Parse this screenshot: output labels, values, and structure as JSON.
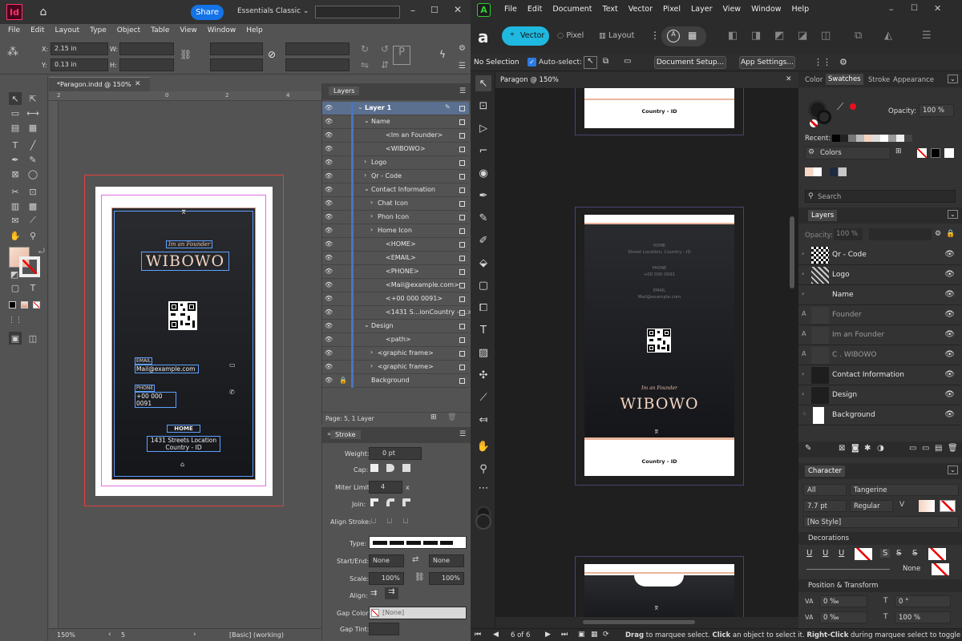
{
  "indesign": {
    "logo": "Id",
    "share": "Share",
    "workspace": "Essentials Classic",
    "menu": [
      "File",
      "Edit",
      "Layout",
      "Type",
      "Object",
      "Table",
      "View",
      "Window",
      "Help"
    ],
    "control": {
      "x_label": "X:",
      "x_val": "2.15 in",
      "y_label": "Y:",
      "y_val": "0.13 in",
      "w_label": "W:",
      "h_label": "H:"
    },
    "doc_tab": "*Paragon.indd @ 150%",
    "ruler": [
      "2",
      "0",
      "2",
      "4"
    ],
    "card": {
      "tagline": "Im an Founder",
      "name": "WIBOWO",
      "email_label": "EMAIL",
      "email": "Mail@example.com",
      "phone_label": "PHONE",
      "phone": "+00 000 0091",
      "home": "HOME",
      "address1": "1431 Streets Location",
      "address2": "Country - ID"
    },
    "status": {
      "zoom": "150%",
      "page": "5",
      "style": "[Basic] (working)"
    },
    "layers": {
      "title": "Layers",
      "footer": "Page: 5, 1 Layer",
      "rows": [
        {
          "name": "Layer 1",
          "indent": 0,
          "arrow": "⌄"
        },
        {
          "name": "Name",
          "indent": 1,
          "arrow": "⌄"
        },
        {
          "name": "<Im an Founder>",
          "indent": 3,
          "arrow": ""
        },
        {
          "name": "<WIBOWO>",
          "indent": 3,
          "arrow": ""
        },
        {
          "name": "Logo",
          "indent": 1,
          "arrow": "›"
        },
        {
          "name": "Qr - Code",
          "indent": 1,
          "arrow": "›"
        },
        {
          "name": "Contact Information",
          "indent": 1,
          "arrow": "⌄"
        },
        {
          "name": "Chat Icon",
          "indent": 2,
          "arrow": "›"
        },
        {
          "name": "Phon Icon",
          "indent": 2,
          "arrow": "›"
        },
        {
          "name": "Home Icon",
          "indent": 2,
          "arrow": "›"
        },
        {
          "name": "<HOME>",
          "indent": 3,
          "arrow": ""
        },
        {
          "name": "<EMAIL>",
          "indent": 3,
          "arrow": ""
        },
        {
          "name": "<PHONE>",
          "indent": 3,
          "arrow": ""
        },
        {
          "name": "<Mail@example.com>",
          "indent": 3,
          "arrow": ""
        },
        {
          "name": "<+00 000 0091>",
          "indent": 3,
          "arrow": ""
        },
        {
          "name": "<1431 S...ionCountry - ...>",
          "indent": 3,
          "arrow": ""
        },
        {
          "name": "Design",
          "indent": 1,
          "arrow": "⌄"
        },
        {
          "name": "<path>",
          "indent": 3,
          "arrow": ""
        },
        {
          "name": "<graphic frame>",
          "indent": 2,
          "arrow": "›"
        },
        {
          "name": "<graphic frame>",
          "indent": 2,
          "arrow": "›"
        },
        {
          "name": "Background",
          "indent": 1,
          "arrow": ""
        }
      ]
    },
    "stroke": {
      "title": "Stroke",
      "weight_label": "Weight:",
      "weight": "0 pt",
      "cap_label": "Cap:",
      "miter_label": "Miter Limit:",
      "miter": "4",
      "miter_x": "x",
      "join_label": "Join:",
      "align_label": "Align Stroke:",
      "type_label": "Type:",
      "startend_label": "Start/End:",
      "start": "None",
      "end": "None",
      "scale_label": "Scale:",
      "scale1": "100%",
      "scale2": "100%",
      "align2_label": "Align:",
      "gapcolor_label": "Gap Color:",
      "gapcolor": "[None]",
      "gaptint_label": "Gap Tint:"
    }
  },
  "affinity": {
    "menu": [
      "File",
      "Edit",
      "Document",
      "Text",
      "Vector",
      "Pixel",
      "Layer",
      "View",
      "Window",
      "Help"
    ],
    "personas": {
      "vector": "Vector",
      "pixel": "Pixel",
      "layout": "Layout"
    },
    "context": {
      "no_selection": "No Selection",
      "autoselect": "Auto-select:",
      "doc_setup": "Document Setup...",
      "app_settings": "App Settings..."
    },
    "doc_tab": "Paragon @ 150%",
    "card_top": {
      "country": "Country - ID"
    },
    "card_mid": {
      "home_label": "HOME",
      "address": "Street Location, Country - ID",
      "phone_label": "PHONE",
      "phone": "+00 000 0091",
      "email_label": "EMAIL",
      "email": "Mail@example.com",
      "tagline": "Im an Founder",
      "name": "WIBOWO",
      "country": "Country - ID"
    },
    "status": {
      "pages": "6 of 6",
      "hint_bold1": "Drag",
      "hint1": " to marquee select. ",
      "hint_bold2": "Click",
      "hint2": " an object to select it. ",
      "hint_bold3": "Right-Click",
      "hint3": " during marquee select to toggle in"
    },
    "swatches": {
      "tabs": [
        "Color",
        "Swatches",
        "Stroke",
        "Appearance"
      ],
      "opacity_label": "Opacity:",
      "opacity": "100 %",
      "recent_label": "Recent:",
      "palette": "Colors",
      "search": "Search"
    },
    "layers": {
      "title": "Layers",
      "opacity_label": "Opacity:",
      "opacity": "100 %",
      "rows": [
        {
          "name": "Qr - Code",
          "thumb": "qr"
        },
        {
          "name": "Logo",
          "thumb": "logo"
        },
        {
          "name": "Name",
          "thumb": "none"
        },
        {
          "name": "Founder",
          "thumb": "text",
          "prefix": "A"
        },
        {
          "name": "Im an Founder",
          "thumb": "text",
          "prefix": "A"
        },
        {
          "name": "C . WIBOWO",
          "thumb": "text",
          "prefix": "A"
        },
        {
          "name": "Contact Information",
          "thumb": "dark"
        },
        {
          "name": "Design",
          "thumb": "dark"
        },
        {
          "name": "Background",
          "thumb": "white"
        }
      ]
    },
    "character": {
      "title": "Character",
      "scope": "All",
      "font": "Tangerine",
      "size": "7.7 pt",
      "weight": "Regular",
      "style": "[No Style]",
      "decorations": "Decorations",
      "none": "None",
      "pos_transform": "Position & Transform",
      "v1": "0 ‰",
      "v2": "0 °",
      "v3": "0 ‰",
      "v4": "100 %"
    }
  }
}
